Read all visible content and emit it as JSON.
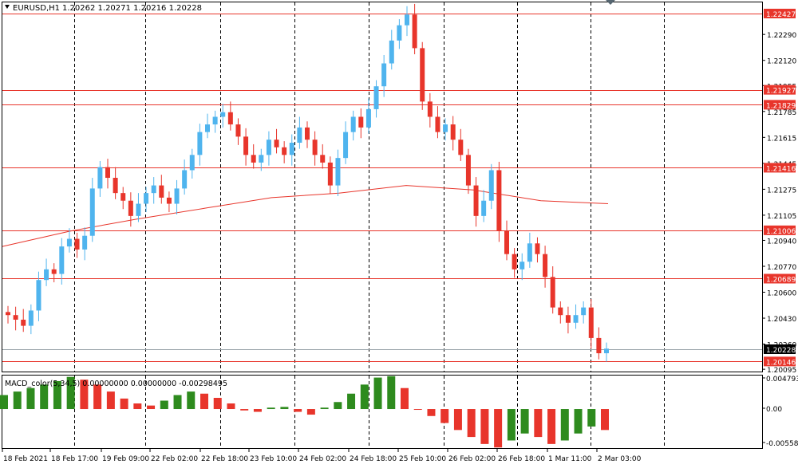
{
  "header": {
    "symbol_timeframe": "EURUSD,H1",
    "ohlc": "1.20262 1.20271 1.20216 1.20228"
  },
  "colors": {
    "bull": "#4fb4ee",
    "bear": "#e8352b",
    "level_line": "#e8352b",
    "ma_line": "#e8352b",
    "grid": "#000000",
    "macd_up": "#2e8b1e",
    "macd_down": "#e8352b",
    "price_tag_text": "#ffffff",
    "current_price_bg": "#000000",
    "current_price_line": "#9aa5ab"
  },
  "price_axis": {
    "ticks": [
      "1.22290",
      "1.22120",
      "1.21955",
      "1.21785",
      "1.21615",
      "1.21445",
      "1.21275",
      "1.21105",
      "1.20940",
      "1.20770",
      "1.20600",
      "1.20430",
      "1.20260",
      "1.20095"
    ]
  },
  "level_lines": [
    {
      "price": 1.22427,
      "label": "1.22427"
    },
    {
      "price": 1.21927,
      "label": "1.21927"
    },
    {
      "price": 1.21829,
      "label": "1.21829"
    },
    {
      "price": 1.21416,
      "label": "1.21416"
    },
    {
      "price": 1.21006,
      "label": "1.21006"
    },
    {
      "price": 1.20689,
      "label": "1.20689"
    },
    {
      "price": 1.20146,
      "label": "1.20146"
    }
  ],
  "current_price": {
    "price": 1.20228,
    "label": "1.20228"
  },
  "time_axis": {
    "labels": [
      "18 Feb 2021",
      "18 Feb 17:00",
      "19 Feb 09:00",
      "22 Feb 02:00",
      "22 Feb 18:00",
      "23 Feb 10:00",
      "24 Feb 02:00",
      "24 Feb 18:00",
      "25 Feb 10:00",
      "26 Feb 02:00",
      "26 Feb 18:00",
      "1 Mar 11:00",
      "2 Mar 03:00"
    ]
  },
  "macd": {
    "title": "MACD_color(5,34,5) 0.00000000 0.00000000 -0.00298495",
    "ticks": [
      "0.0047939",
      "0.00",
      "-0.005587"
    ]
  },
  "chart_data": {
    "type": "candlestick",
    "symbol": "EURUSD",
    "timeframe": "H1",
    "ylim": [
      1.2008,
      1.225
    ],
    "last_close": 1.20228,
    "closes": [
      1.2045,
      1.2042,
      1.2038,
      1.2048,
      1.2068,
      1.2075,
      1.2072,
      1.209,
      1.2095,
      1.2088,
      1.2097,
      1.2128,
      1.2142,
      1.2135,
      1.2125,
      1.212,
      1.211,
      1.2118,
      1.2125,
      1.213,
      1.2122,
      1.2118,
      1.2128,
      1.214,
      1.215,
      1.2165,
      1.217,
      1.2175,
      1.2178,
      1.217,
      1.2162,
      1.215,
      1.2145,
      1.215,
      1.216,
      1.2155,
      1.215,
      1.2158,
      1.2168,
      1.216,
      1.215,
      1.2145,
      1.213,
      1.2148,
      1.2165,
      1.2175,
      1.2168,
      1.218,
      1.2195,
      1.221,
      1.2225,
      1.2235,
      1.2242,
      1.222,
      1.2185,
      1.2175,
      1.2165,
      1.217,
      1.216,
      1.215,
      1.213,
      1.211,
      1.212,
      1.214,
      1.21,
      1.2085,
      1.2075,
      1.208,
      1.2092,
      1.2085,
      1.207,
      1.205,
      1.2045,
      1.204,
      1.2045,
      1.205,
      1.203,
      1.202,
      1.2023
    ],
    "ma": [
      1.209,
      1.21,
      1.2108,
      1.2115,
      1.2122,
      1.2125,
      1.213,
      1.2127,
      1.212,
      1.2118
    ],
    "macd_histogram": [
      0.002,
      0.0025,
      0.003,
      0.0035,
      0.004,
      0.0046,
      0.0042,
      0.0035,
      0.0025,
      0.0015,
      0.0008,
      0.0005,
      0.0012,
      0.002,
      0.0025,
      0.0022,
      0.0016,
      0.0008,
      -0.0002,
      -0.0004,
      0.0002,
      0.0003,
      -0.0004,
      -0.0008,
      0.0002,
      0.001,
      0.0022,
      0.0035,
      0.0045,
      0.0047,
      0.003,
      0.0,
      -0.001,
      -0.002,
      -0.003,
      -0.004,
      -0.005,
      -0.0055,
      -0.0045,
      -0.0035,
      -0.004,
      -0.005,
      -0.0045,
      -0.0035,
      -0.0025,
      -0.003
    ],
    "macd_ylim": [
      -0.005587,
      0.0047939
    ]
  }
}
